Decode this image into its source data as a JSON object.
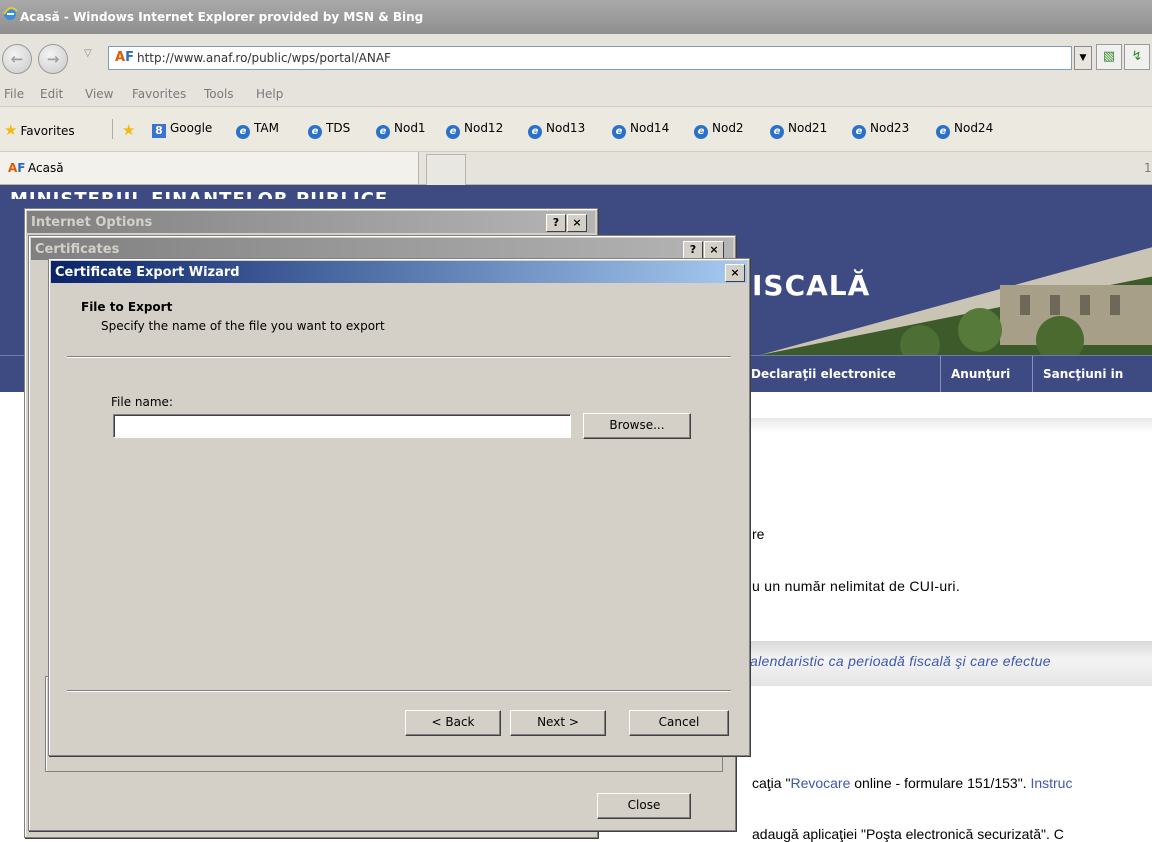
{
  "browser": {
    "window_title": "Acasă - Windows Internet Explorer provided by MSN & Bing",
    "address": "http://www.anaf.ro/public/wps/portal/ANAF",
    "menu": [
      "File",
      "Edit",
      "View",
      "Favorites",
      "Tools",
      "Help"
    ],
    "favorites_label": "Favorites",
    "favorites_items": [
      "Google",
      "TAM",
      "TDS",
      "Nod1",
      "Nod12",
      "Nod13",
      "Nod14",
      "Nod2",
      "Nod21",
      "Nod23",
      "Nod24"
    ],
    "tab_label": "Acasă",
    "tab_count_hint": "1"
  },
  "page": {
    "header_ministry": "MINISTERUL FINANTELOR PUBLICE",
    "header_title": "ISCALĂ",
    "nav": [
      "Declaraţii electronice",
      "Anunţuri",
      "Sancţiuni in"
    ],
    "lines": [
      "re",
      "u un număr nelimitat de CUI-uri.",
      "alendaristic ca perioadă fiscală şi care efectue",
      "caţia ",
      "Revocare",
      " online - formulare 151/153\". ",
      "Instruc",
      "adaugă aplicaţiei \"Poşta electronică securizată\". C"
    ],
    "line_quote_prefix": "\""
  },
  "dialogs": {
    "internet_options": {
      "title": "Internet Options",
      "help": "?",
      "close": "×"
    },
    "certificates": {
      "title": "Certificates",
      "help": "?",
      "close": "×",
      "close_button": "Close"
    },
    "wizard": {
      "title": "Certificate Export Wizard",
      "close": "×",
      "heading": "File to Export",
      "subheading": "Specify the name of the file you want to export",
      "file_name_label": "File name:",
      "file_name_value": "",
      "browse_label": "Browse...",
      "back_label": "< Back",
      "next_label": "Next >",
      "cancel_label": "Cancel"
    }
  },
  "colors": {
    "header_bg": "#3e4a82",
    "dialog_face": "#d4d0c8",
    "active_title": "#0a246a",
    "link": "#3c57b0"
  }
}
